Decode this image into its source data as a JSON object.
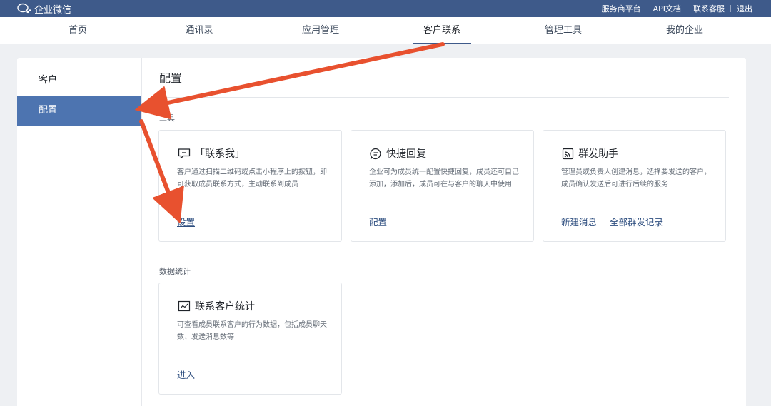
{
  "header": {
    "brand": "企业微信",
    "links": [
      "服务商平台",
      "API文档",
      "联系客服",
      "退出"
    ]
  },
  "nav": {
    "items": [
      "首页",
      "通讯录",
      "应用管理",
      "客户联系",
      "管理工具",
      "我的企业"
    ],
    "active": "客户联系"
  },
  "sidebar": {
    "items": [
      "客户",
      "配置"
    ],
    "active": "配置"
  },
  "main": {
    "title": "配置",
    "sections": [
      {
        "title": "工具",
        "cards": [
          {
            "icon": "chat-bubble-icon",
            "title": "「联系我」",
            "desc": "客户通过扫描二维码或点击小程序上的按钮，即可获取成员联系方式，主动联系到成员",
            "actions": [
              "设置"
            ]
          },
          {
            "icon": "quick-reply-icon",
            "title": "快捷回复",
            "desc": "企业可为成员统一配置快捷回复，成员还可自己添加，添加后，成员可在与客户的聊天中使用",
            "actions": [
              "配置"
            ]
          },
          {
            "icon": "broadcast-icon",
            "title": "群发助手",
            "desc": "管理员或负责人创建消息，选择要发送的客户，成员确认发送后可进行后续的服务",
            "actions": [
              "新建消息",
              "全部群发记录"
            ]
          }
        ]
      },
      {
        "title": "数据统计",
        "cards": [
          {
            "icon": "stats-chart-icon",
            "title": "联系客户统计",
            "desc": "可查看成员联系客户的行为数据，包括成员聊天数、发送消息数等",
            "actions": [
              "进入"
            ]
          }
        ]
      }
    ]
  },
  "colors": {
    "header_bg": "#3e5a8a",
    "sidebar_active": "#4d74b0",
    "link": "#2f4f80",
    "annotation_arrow": "#e8512f"
  }
}
